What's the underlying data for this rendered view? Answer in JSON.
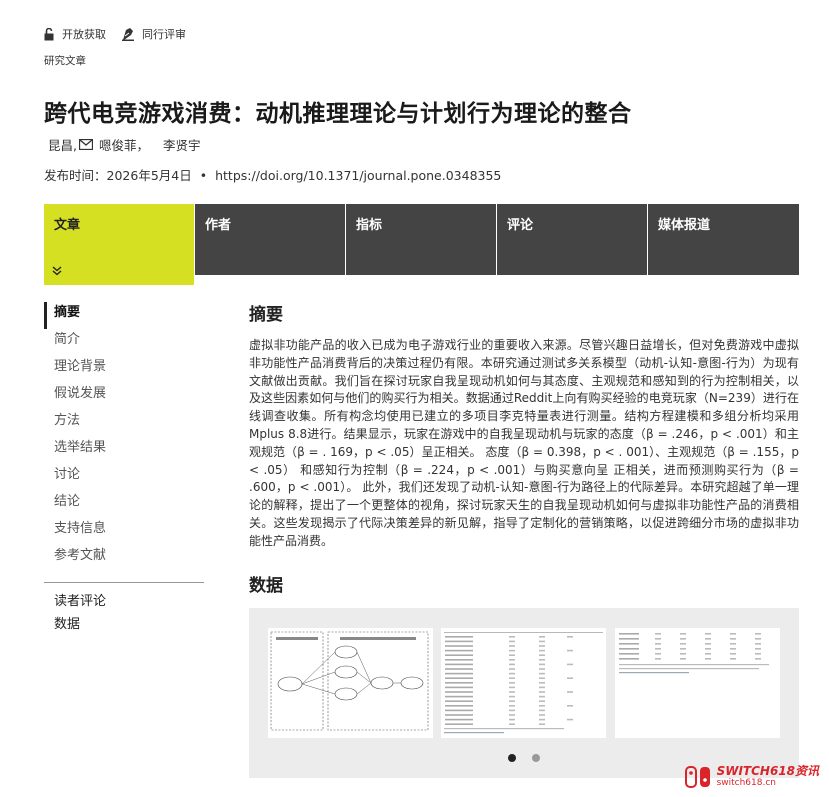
{
  "header": {
    "badges": [
      {
        "label": "开放获取",
        "icon": "open-lock-icon"
      },
      {
        "label": "同行评审",
        "icon": "peer-review-icon"
      }
    ],
    "article_type": "研究文章",
    "title": "跨代电竞游戏消费：动机推理理论与计划行为理论的整合",
    "authors": [
      "昆昌,",
      "嗯俊菲，",
      "李贤宇"
    ],
    "published_label": "发布时间：",
    "published_date": "2026年5月4日",
    "doi": "https://doi.org/10.1371/journal.pone.0348355"
  },
  "tabs": [
    {
      "label": "文章",
      "active": true
    },
    {
      "label": "作者",
      "active": false
    },
    {
      "label": "指标",
      "active": false
    },
    {
      "label": "评论",
      "active": false
    },
    {
      "label": "媒体报道",
      "active": false
    }
  ],
  "nav": {
    "items": [
      "摘要",
      "简介",
      "理论背景",
      "假说发展",
      "方法",
      "选举结果",
      "讨论",
      "结论",
      "支持信息",
      "参考文献"
    ],
    "secondary": [
      "读者评论",
      "数据"
    ]
  },
  "abstract": {
    "heading": "摘要",
    "text": "虚拟非功能产品的收入已成为电子游戏行业的重要收入来源。尽管兴趣日益增长，但对免费游戏中虚拟非功能性产品消费背后的决策过程仍有限。本研究通过测试多关系模型（动机-认知-意图-行为）为现有文献做出贡献。我们旨在探讨玩家自我呈现动机如何与其态度、主观规范和感知到的行为控制相关，以及这些因素如何与他们的购买行为相关。数据通过Reddit上向有购买经验的电竞玩家（N=239）进行在线调查收集。所有构念均使用已建立的多项目李克特量表进行测量。结构方程建模和多组分析均采用Mplus 8.8进行。结果显示，玩家在游戏中的自我呈现动机与玩家的态度（β = .246，p < .001）和主观规范（β = . 169，p < .05）呈正相关。 态度（β = 0.398，p < . 001）、主观规范（β = .155，p < .05） 和感知行为控制（β = .224，p < .001）与购买意向呈 正相关，进而预测购买行为（β = .600，p < .001）。 此外，我们还发现了动机-认知-意图-行为路径上的代际差异。本研究超越了单一理论的解释，提出了一个更整体的视角，探讨玩家天生的自我呈现动机如何与虚拟非功能性产品的消费相关。这些发现揭示了代际决策差异的新见解，指导了定制化的营销策略，以促进跨细分市场的虚拟非功能性产品消费。"
  },
  "data_section": {
    "heading": "数据",
    "carousel_page": 1,
    "carousel_pages": 2
  },
  "watermark": {
    "main": "SWITCH618资讯",
    "sub": "switch618.cn",
    "color": "#d9252a"
  },
  "colors": {
    "accent": "#d4e021",
    "tab_bg": "#444444"
  }
}
